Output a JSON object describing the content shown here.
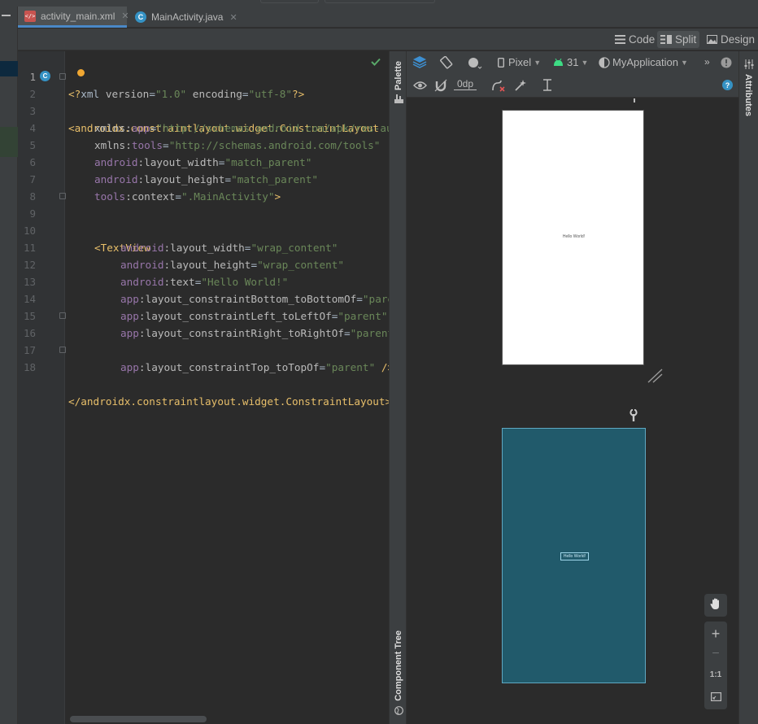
{
  "tabs": [
    {
      "label": "activity_main.xml",
      "icon": "xml-file-icon",
      "active": true
    },
    {
      "label": "MainActivity.java",
      "icon": "java-class-icon",
      "active": false
    }
  ],
  "modes": {
    "code": "Code",
    "split": "Split",
    "design": "Design",
    "active": "Split"
  },
  "editor": {
    "lines": [
      {
        "n": "1"
      },
      {
        "n": "2"
      },
      {
        "n": "3"
      },
      {
        "n": "4"
      },
      {
        "n": "5"
      },
      {
        "n": "6"
      },
      {
        "n": "7"
      },
      {
        "n": "8"
      },
      {
        "n": "9"
      },
      {
        "n": "10"
      },
      {
        "n": "11"
      },
      {
        "n": "12"
      },
      {
        "n": "13"
      },
      {
        "n": "14"
      },
      {
        "n": "15"
      },
      {
        "n": "16"
      },
      {
        "n": "17"
      },
      {
        "n": "18"
      }
    ],
    "code": {
      "l1_a": "<?",
      "l1_b": "xml ",
      "l1_c": "version",
      "l1_d": "=",
      "l1_e": "\"1.0\"",
      "l1_f": " encoding",
      "l1_g": "=",
      "l1_h": "\"utf-8\"",
      "l1_i": "?>",
      "l2": "androidx.constraintlayout.widget.ConstraintLayout",
      "l3_ns": "app",
      "l3_val": "\"http://schemas.android.com/apk/res-auto\"",
      "l4_ns": "tools",
      "l4_val": "\"http://schemas.android.com/tools\"",
      "l5_attr": "layout_width",
      "l5_val": "\"match_parent\"",
      "l6_attr": "layout_height",
      "l6_val": "\"match_parent\"",
      "l7_attr": "context",
      "l7_val": "\".MainActivity\"",
      "l9": "<TextView",
      "l10_attr": "layout_width",
      "l10_val": "\"wrap_content\"",
      "l11_attr": "layout_height",
      "l11_val": "\"wrap_content\"",
      "l12_attr": "text",
      "l12_val": "\"Hello World!\"",
      "l13_attr": "layout_constraintBottom_toBottomOf",
      "l13_val": "\"parent\"",
      "l14_attr": "layout_constraintLeft_toLeftOf",
      "l14_val": "\"parent\"",
      "l15_attr": "layout_constraintRight_toRightOf",
      "l15_val": "\"parent\"",
      "l16_attr": "layout_constraintTop_toTopOf",
      "l16_val": "\"parent\"",
      "l18": "</androidx.constraintlayout.widget.ConstraintLayout>",
      "xmlns": "xmlns",
      "android": "android",
      "app": "app",
      "tools": "tools"
    }
  },
  "side_panels": {
    "palette": "Palette",
    "component_tree": "Component Tree",
    "attributes": "Attributes"
  },
  "design_toolbar": {
    "device": "Pixel",
    "api": "31",
    "theme": "MyApplication",
    "margin": "0dp"
  },
  "preview": {
    "text": "Hello World!"
  },
  "zoom": {
    "plus": "+",
    "minus": "−",
    "one_to_one": "1:1"
  }
}
